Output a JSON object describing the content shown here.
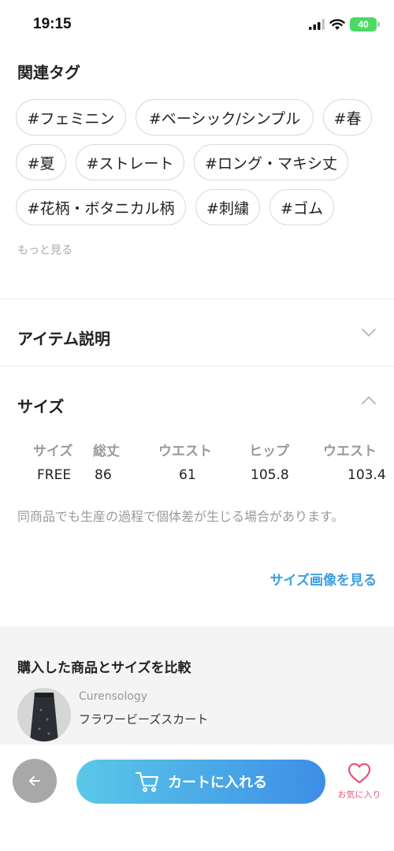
{
  "status_bar": {
    "time": "19:15",
    "battery": "40"
  },
  "tags_section": {
    "title": "関連タグ",
    "tags": [
      "#フェミニン",
      "#ベーシック/シンプル",
      "#春",
      "#夏",
      "#ストレート",
      "#ロング・マキシ丈",
      "#花柄・ボタニカル柄",
      "#刺繍",
      "#ゴム"
    ],
    "more_label": "もっと見る"
  },
  "item_description": {
    "title": "アイテム説明"
  },
  "size_section": {
    "title": "サイズ",
    "headers": [
      "サイズ",
      "総丈",
      "ウエスト",
      "ヒップ",
      "ウエスト"
    ],
    "values": [
      "FREE",
      "86",
      "61",
      "105.8",
      "103.4"
    ],
    "note": "同商品でも生産の過程で個体差が生じる場合があります。",
    "size_image_link": "サイズ画像を見る"
  },
  "compare_section": {
    "title": "購入した商品とサイズを比較",
    "brand": "Curensology",
    "product_name": "フラワービーズスカート"
  },
  "bottom_bar": {
    "cart_label": "カートに入れる",
    "favorite_label": "お気に入り"
  },
  "colors": {
    "accent_blue": "#3b9fe0",
    "cart_gradient_start": "#5ac8e8",
    "cart_gradient_end": "#3d8ee6",
    "favorite_pink": "#e9547a",
    "battery_green": "#4cd964"
  },
  "icons": [
    "signal-icon",
    "wifi-icon",
    "battery-icon",
    "chevron-down-icon",
    "chevron-up-icon",
    "back-arrow-icon",
    "cart-icon",
    "heart-icon"
  ]
}
